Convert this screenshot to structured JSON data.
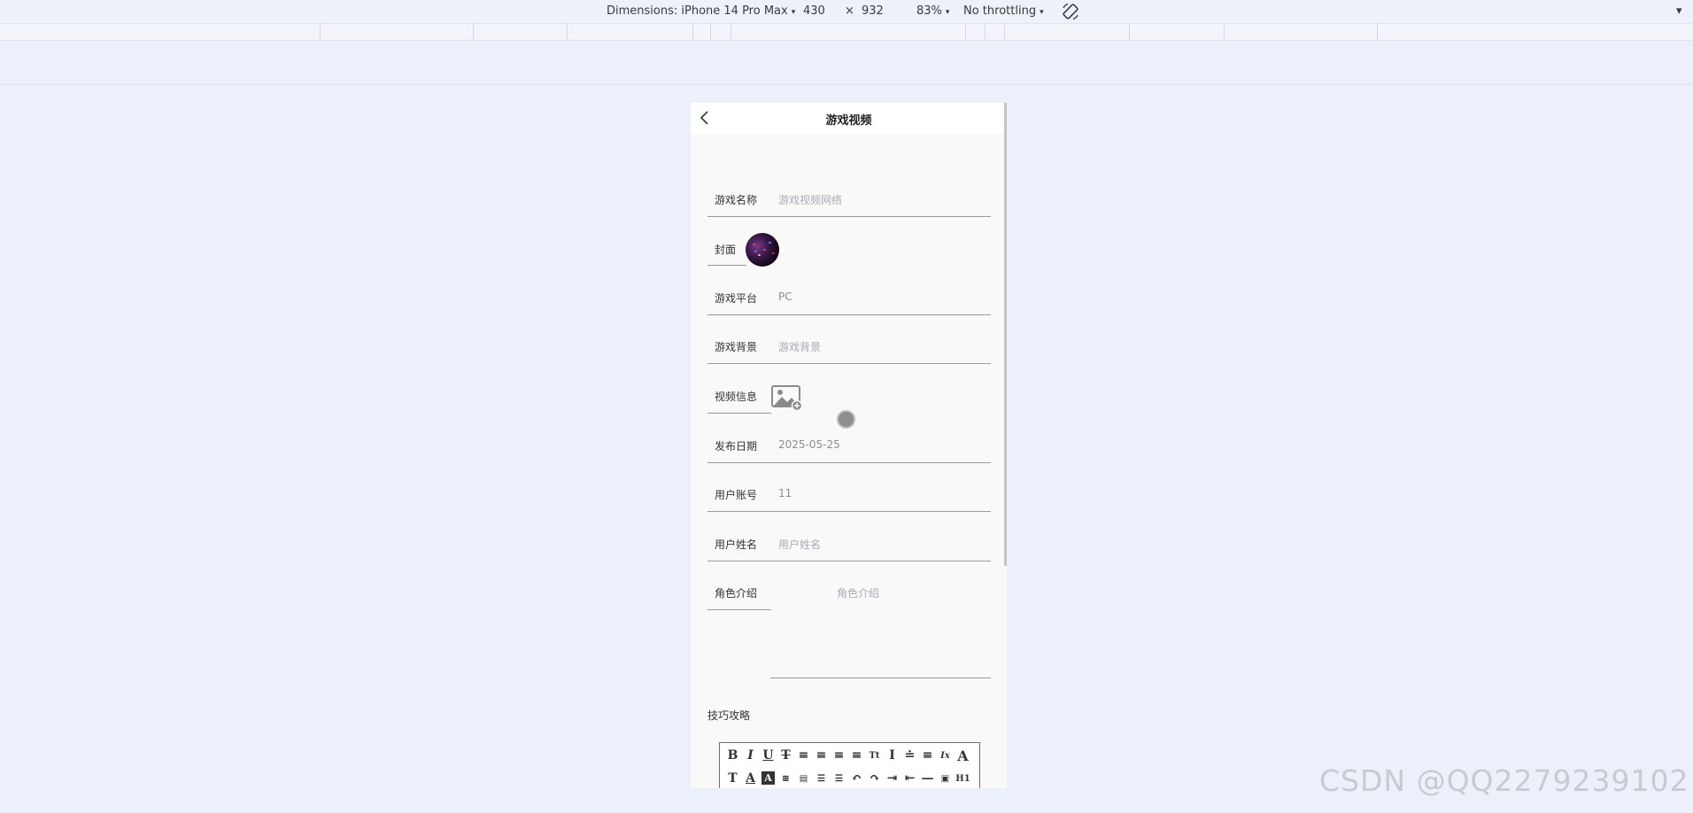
{
  "devtools": {
    "dimensions_label": "Dimensions: iPhone 14 Pro Max",
    "width_value": "430",
    "times": "×",
    "height_value": "932",
    "zoom": "83%",
    "throttling": "No throttling",
    "caret": "▾"
  },
  "page": {
    "title": "游戏视频",
    "fields": {
      "game_name": {
        "label": "游戏名称",
        "placeholder": "游戏视频网络"
      },
      "cover": {
        "label": "封面"
      },
      "platform": {
        "label": "游戏平台",
        "value": "PC"
      },
      "background": {
        "label": "游戏背景",
        "placeholder": "游戏背景"
      },
      "video_info": {
        "label": "视频信息"
      },
      "release_date": {
        "label": "发布日期",
        "value": "2025-05-25"
      },
      "user_account": {
        "label": "用户账号",
        "value": "11"
      },
      "user_name": {
        "label": "用户姓名",
        "placeholder": "用户姓名"
      },
      "role_intro": {
        "label": "角色介绍",
        "placeholder": "角色介绍"
      },
      "tips": {
        "label": "技巧攻略"
      }
    },
    "editor_toolbar": {
      "row1": [
        "B",
        "I",
        "U",
        "T",
        "≡",
        "≡",
        "≡",
        "≡",
        "Tt",
        "I",
        "≐",
        "≡",
        "Ix",
        "A"
      ],
      "row2": [
        "T",
        "A",
        "A",
        "⊞",
        "▤",
        "☰",
        "☰",
        "↶",
        "↷",
        "⇥",
        "⇤",
        "—",
        "▣",
        "H1"
      ]
    }
  },
  "watermark": "CSDN @QQ2279239102",
  "colors": {
    "page_bg": "#ecf0fa",
    "phone_bg": "#f9f9f9",
    "underline": "#9a9a9a"
  }
}
